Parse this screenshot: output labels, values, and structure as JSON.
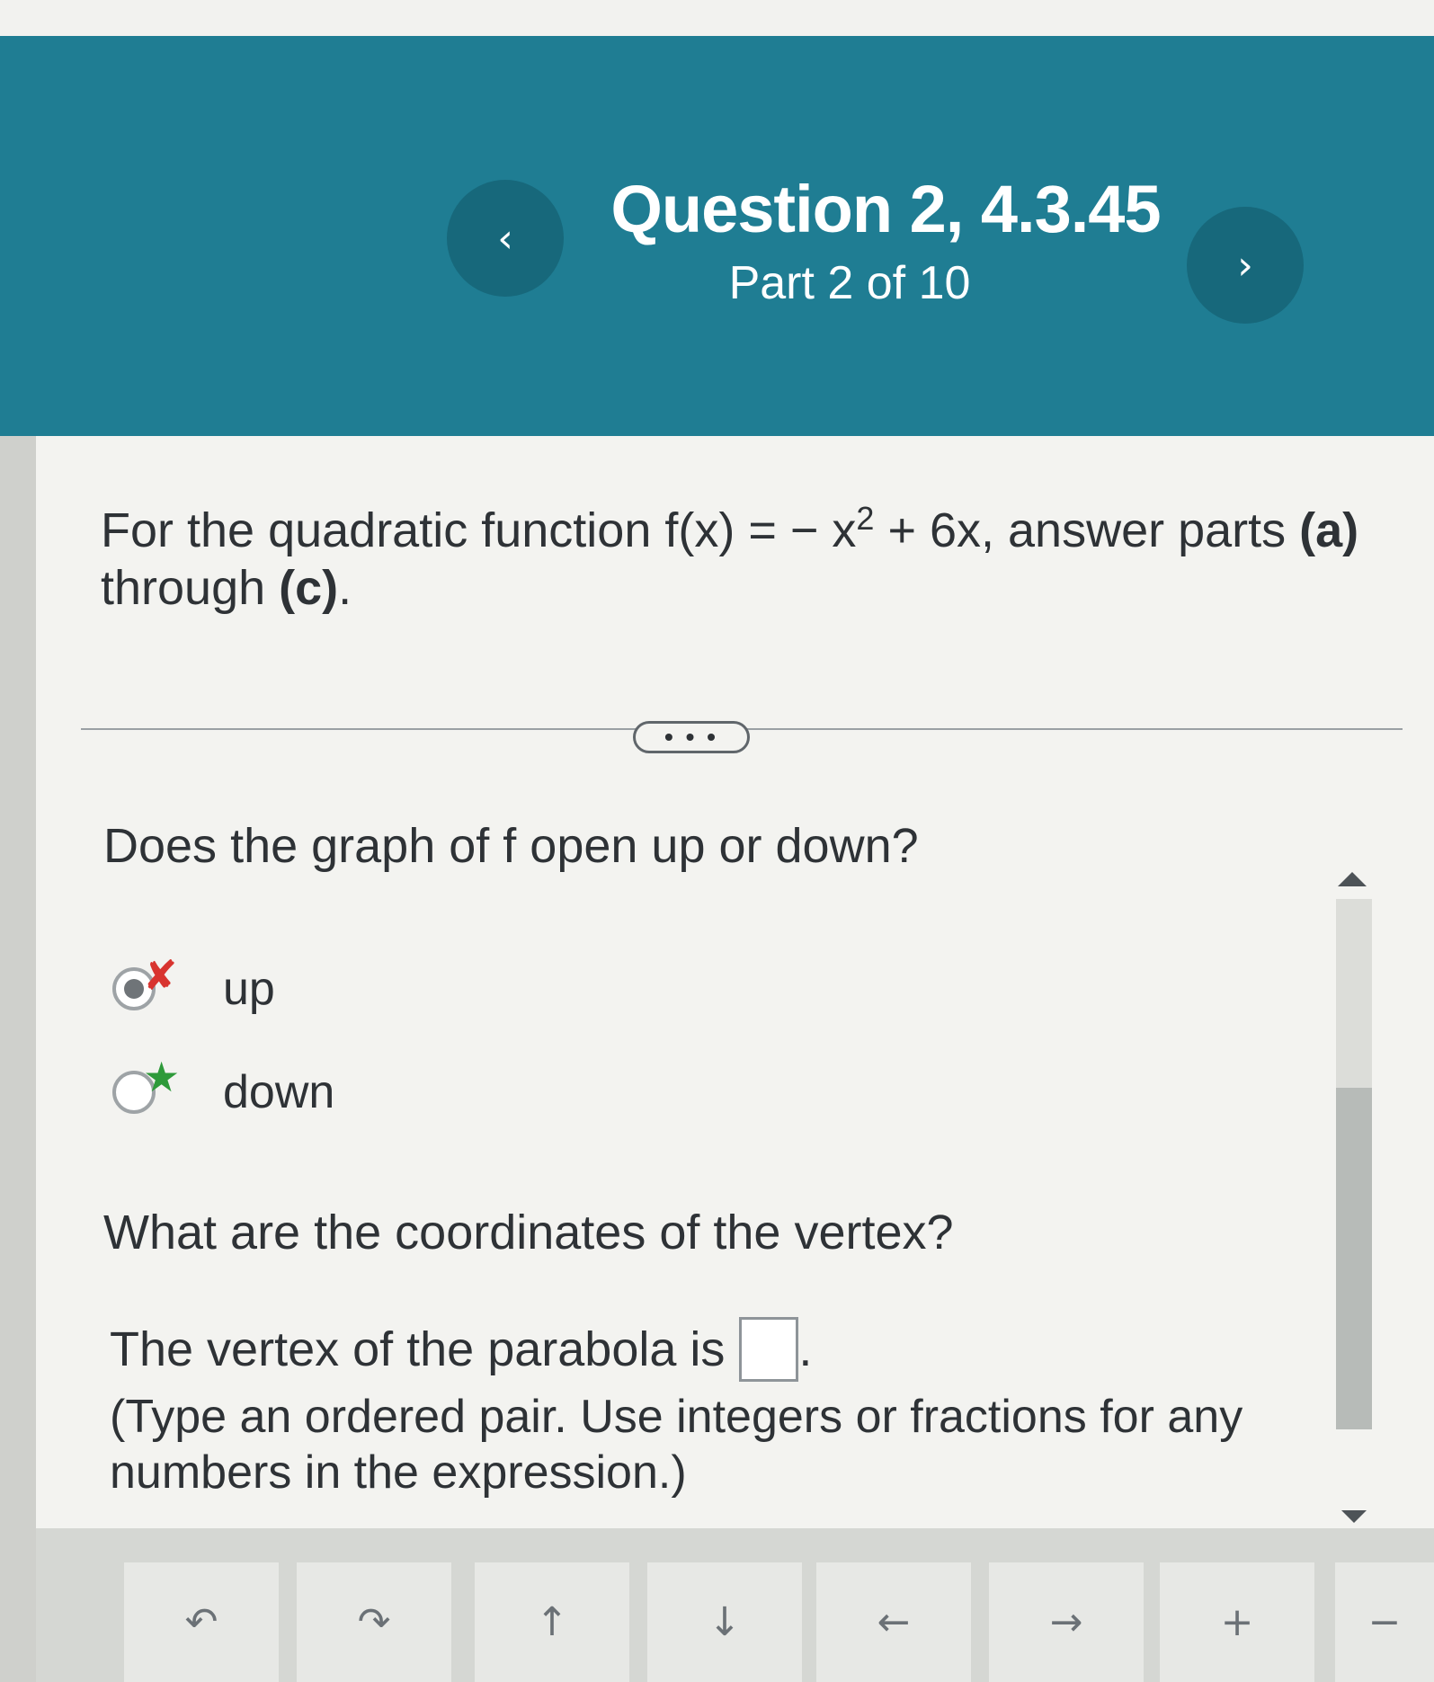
{
  "header": {
    "title": "Question 2, 4.3.45",
    "subtitle": "Part 2 of 10",
    "prev_icon": "‹",
    "next_icon": "›"
  },
  "stem": {
    "prefix": "For the quadratic function f(x) = − x",
    "exponent": "2",
    "middle": " + 6x, answer parts ",
    "part_a": "(a)",
    "through": " through ",
    "part_c": "(c)",
    "end": "."
  },
  "more_label": "• • •",
  "question1": {
    "text": "Does the graph of f open up or down?",
    "options": [
      {
        "label": "up",
        "selected": true,
        "status": "incorrect"
      },
      {
        "label": "down",
        "selected": false,
        "status": "correct"
      }
    ]
  },
  "question2": {
    "text": "What are the coordinates of the vertex?",
    "answer_prefix": "The vertex of the parabola is",
    "answer_value": "",
    "answer_suffix": ".",
    "hint": "(Type an ordered pair. Use integers or fractions for any numbers in the expression.)"
  },
  "toolbar": {
    "buttons": [
      {
        "icon": "undo-icon",
        "glyph": "↶"
      },
      {
        "icon": "redo-icon",
        "glyph": "↷"
      },
      {
        "icon": "arrow-up-icon",
        "glyph": "↑"
      },
      {
        "icon": "arrow-down-icon",
        "glyph": "↓"
      },
      {
        "icon": "arrow-left-icon",
        "glyph": "←"
      },
      {
        "icon": "arrow-right-icon",
        "glyph": "→"
      },
      {
        "icon": "plus-icon",
        "glyph": "+"
      },
      {
        "icon": "minus-icon",
        "glyph": "−"
      }
    ]
  },
  "colors": {
    "header_bg": "#1f7d93",
    "incorrect": "#d8342f",
    "correct": "#2e9a3a"
  }
}
